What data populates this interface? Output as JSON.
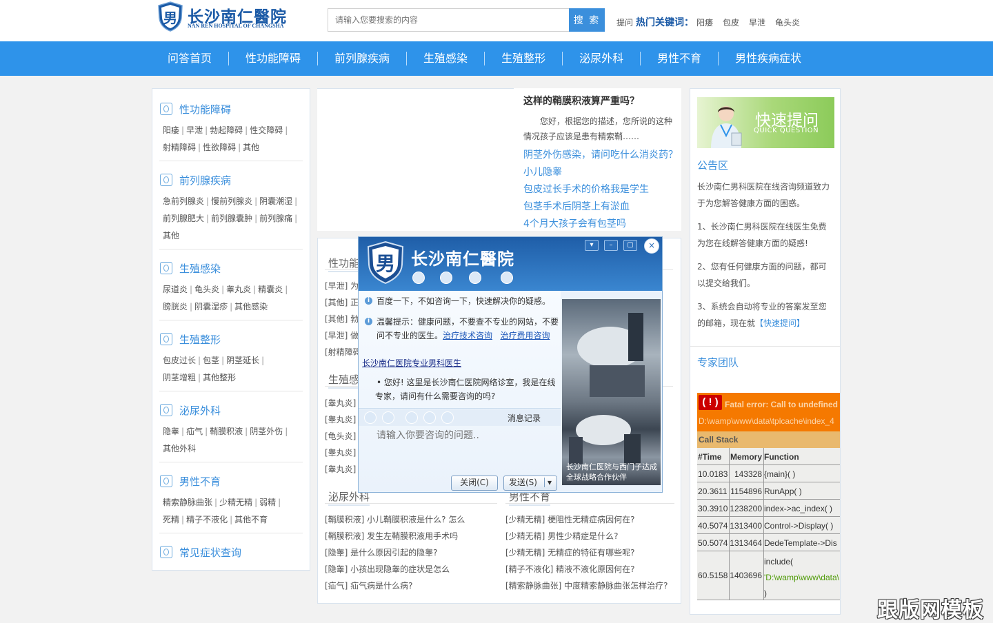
{
  "header": {
    "logo_title": "长沙南仁醫院",
    "logo_sub": "NAN REN HOSPITAL OF CHANGSHA",
    "logo_char": "男",
    "search_placeholder": "请输入您要搜索的内容",
    "search_button": "搜 索",
    "hot_prefix": "提问",
    "hot_title": "热门关键词：",
    "keywords": [
      "阳痿",
      "包皮",
      "早泄",
      "龟头炎"
    ]
  },
  "nav": [
    "问答首页",
    "性功能障碍",
    "前列腺疾病",
    "生殖感染",
    "生殖整形",
    "泌尿外科",
    "男性不育",
    "男性疾病症状"
  ],
  "sidebar": {
    "categories": [
      {
        "title": "性功能障碍",
        "lines": [
          [
            "阳痿",
            "早泄",
            "勃起障碍",
            "性交障碍"
          ],
          [
            "射精障碍",
            "性欲障碍",
            "其他"
          ]
        ]
      },
      {
        "title": "前列腺疾病",
        "lines": [
          [
            "急前列腺炎",
            "慢前列腺炎",
            "阴囊潮湿"
          ],
          [
            "前列腺肥大",
            "前列腺囊肿",
            "前列腺痛"
          ],
          [
            "其他"
          ]
        ]
      },
      {
        "title": "生殖感染",
        "lines": [
          [
            "尿道炎",
            "龟头炎",
            "睾丸炎",
            "精囊炎"
          ],
          [
            "膀胱炎",
            "阴囊湿疹",
            "其他感染"
          ]
        ]
      },
      {
        "title": "生殖整形",
        "lines": [
          [
            "包皮过长",
            "包茎",
            "阴茎延长"
          ],
          [
            "阴茎增粗",
            "其他整形"
          ]
        ]
      },
      {
        "title": "泌尿外科",
        "lines": [
          [
            "隐睾",
            "疝气",
            "鞘膜积液",
            "阴茎外伤"
          ],
          [
            "其他外科"
          ]
        ]
      },
      {
        "title": "男性不育",
        "lines": [
          [
            "精索静脉曲张",
            "少精无精",
            "弱精"
          ],
          [
            "死精",
            "精子不液化",
            "其他不育"
          ]
        ]
      },
      {
        "title": "常见症状查询",
        "lines": []
      }
    ]
  },
  "featured": {
    "title": "这样的鞘膜积液算严重吗？",
    "desc": "您好，根据您的描述，您所说的这种情况孩子应该是患有精索鞘……",
    "links": [
      "阴茎外伤感染，请问吃什么消炎药？",
      "小儿隐睾",
      "包皮过长手术的价格我是学生",
      "包茎手术后阴茎上有淤血",
      "4个月大孩子会有包茎吗"
    ]
  },
  "sections": {
    "s1_title": "性功能",
    "s1_items": [
      "[早泄] 为什",
      "[其他] 正常",
      "[其他] 勃起",
      "[早泄] 做爱",
      "[射精障碍"
    ],
    "s2_title": "生殖感",
    "s2_items": [
      "[睾丸炎] 睾",
      "[睾丸炎] 睾",
      "[龟头炎] 龟",
      "[睾丸炎] 睾",
      "[睾丸炎] 睾"
    ],
    "s3_title": "泌尿外科",
    "s3_items": [
      "[鞘膜积液] 小儿鞘膜积液是什么? 怎么",
      "[鞘膜积液] 发生左鞘膜积液用手术吗",
      "[隐睾] 是什么原因引起的隐睾?",
      "[隐睾] 小孩出现隐睾的症状是怎么",
      "[疝气] 疝气病是什么病?"
    ],
    "s4_title": "男性不育",
    "s4_items": [
      "[少精无精] 梗阻性无精症病因何在?",
      "[少精无精] 男性少精症是什么?",
      "[少精无精] 无精症的特征有哪些呢?",
      "[精子不液化] 精液不液化原因何在?",
      "[精索静脉曲张] 中度精索静脉曲张怎样治疗?"
    ]
  },
  "right": {
    "banner_title": "快速提问",
    "banner_sub": "QUICK QUESTION",
    "notice_title": "公告区",
    "notice_p1": "长沙南仁男科医院在线咨询频道致力于为您解答健康方面的困惑。",
    "notice_p2": "1、长沙南仁男科医院在线医生免费为您在线解答健康方面的疑惑!",
    "notice_p3": "2、您有任何健康方面的问题，都可以提交给我们。",
    "notice_p4a": "3、系统会自动将专业的答案发至您的邮箱，现在就",
    "notice_p4b": "【快速提问】",
    "team_title": "专家团队"
  },
  "error": {
    "badge": "( ! )",
    "message": "Fatal error: Call to undefined f",
    "path": "D:\\wamp\\www\\data\\tplcache\\index_4",
    "call_stack": "Call Stack",
    "headers": [
      "#Time",
      "Memory",
      "Function"
    ],
    "rows": [
      {
        "n": "1",
        "time": "0.0183",
        "mem": "143328",
        "fn": "{main}( )"
      },
      {
        "n": "2",
        "time": "0.3611",
        "mem": "1154896",
        "fn": "RunApp( )"
      },
      {
        "n": "3",
        "time": "0.3910",
        "mem": "1238200",
        "fn": "index->ac_index( )"
      },
      {
        "n": "4",
        "time": "0.5074",
        "mem": "1313400",
        "fn": "Control->Display( )"
      },
      {
        "n": "5",
        "time": "0.5074",
        "mem": "1313464",
        "fn": "DedeTemplate->Dis"
      },
      {
        "n": "6",
        "time": "0.5158",
        "mem": "1403696",
        "fn_a": "include(",
        "fn_b": "'D:\\wamp\\www\\data\\",
        "fn_c": ")"
      }
    ]
  },
  "chat": {
    "title": "长沙南仁醫院",
    "logo_char": "男",
    "line1": "百度一下，不如咨询一下，快速解决你的疑惑。",
    "line2a": "温馨提示：健康问题，不要查不专业的网站，不要",
    "line2b": "问不专业的医生。",
    "link1": "治疗技术咨询",
    "link2": "治疗费用咨询",
    "doctor_link": "长沙南仁医院专业男科医生",
    "greet_a": "• 您好! 这里是长沙南仁医院网络诊室，我是在线",
    "greet_b": "专家，请问有什么需要咨询的吗?",
    "history": "消息记录",
    "input_placeholder": "请输入你要咨询的问题..",
    "close_btn": "关闭(C)",
    "send_btn": "发送(S)",
    "photo_caption": "长沙南仁医院与西门子达成全球战略合作伙伴"
  },
  "watermark": "跟版网模板"
}
